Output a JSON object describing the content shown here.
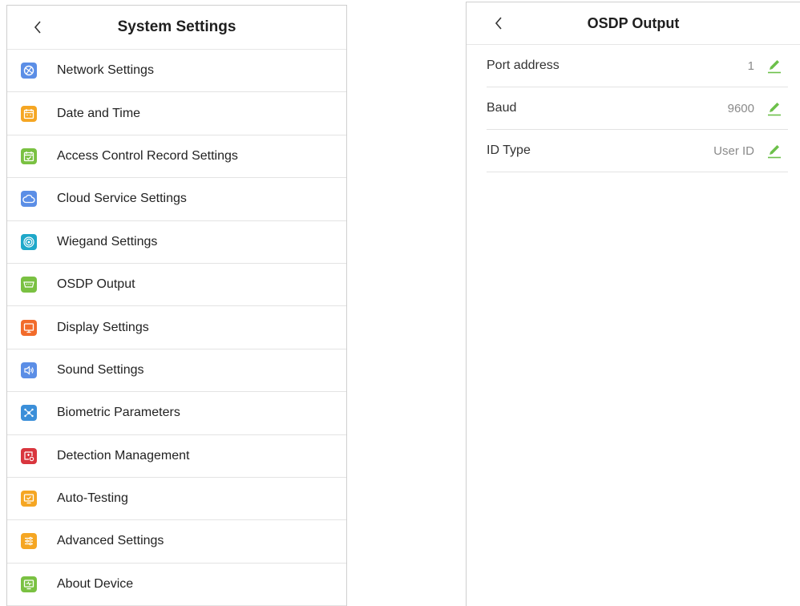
{
  "system_settings": {
    "title": "System Settings",
    "items": [
      {
        "label": "Network Settings",
        "icon": "network-icon",
        "color": "#5b8ee6"
      },
      {
        "label": "Date and Time",
        "icon": "calendar-icon",
        "color": "#f5a623"
      },
      {
        "label": "Access Control Record Settings",
        "icon": "calendar-check-icon",
        "color": "#7ac142"
      },
      {
        "label": "Cloud Service Settings",
        "icon": "cloud-icon",
        "color": "#5b8ee6"
      },
      {
        "label": "Wiegand Settings",
        "icon": "wiegand-icon",
        "color": "#1fa8c9"
      },
      {
        "label": "OSDP Output",
        "icon": "osdp-icon",
        "color": "#7ac142"
      },
      {
        "label": "Display Settings",
        "icon": "display-icon",
        "color": "#f26b2b"
      },
      {
        "label": "Sound Settings",
        "icon": "sound-icon",
        "color": "#5b8ee6"
      },
      {
        "label": "Biometric Parameters",
        "icon": "biometric-icon",
        "color": "#3b8fd9"
      },
      {
        "label": "Detection Management",
        "icon": "detection-icon",
        "color": "#d9363e"
      },
      {
        "label": "Auto-Testing",
        "icon": "auto-testing-icon",
        "color": "#f5a623"
      },
      {
        "label": "Advanced Settings",
        "icon": "advanced-settings-icon",
        "color": "#f5a623"
      },
      {
        "label": "About Device",
        "icon": "about-device-icon",
        "color": "#7ac142"
      }
    ]
  },
  "osdp_output": {
    "title": "OSDP Output",
    "rows": [
      {
        "label": "Port address",
        "value": "1"
      },
      {
        "label": "Baud",
        "value": "9600"
      },
      {
        "label": "ID Type",
        "value": "User ID"
      }
    ],
    "edit_color": "#6cc04a"
  }
}
